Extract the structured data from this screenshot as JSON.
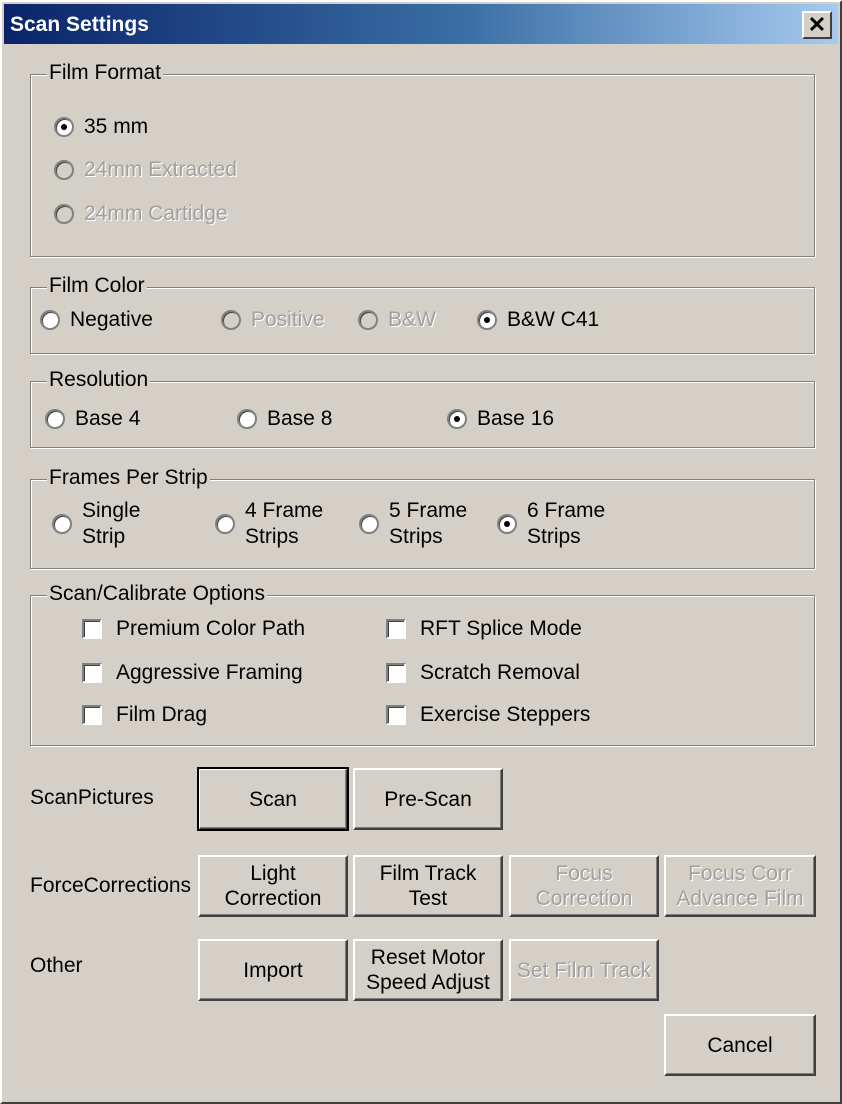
{
  "window": {
    "title": "Scan Settings",
    "close_glyph": "✕"
  },
  "film_format": {
    "label": "Film Format",
    "options": [
      {
        "label": "35 mm",
        "selected": true,
        "enabled": true
      },
      {
        "label": "24mm Extracted",
        "selected": false,
        "enabled": false
      },
      {
        "label": "24mm Cartidge",
        "selected": false,
        "enabled": false
      }
    ]
  },
  "film_color": {
    "label": "Film Color",
    "options": [
      {
        "label": "Negative",
        "selected": false,
        "enabled": true
      },
      {
        "label": "Positive",
        "selected": false,
        "enabled": false
      },
      {
        "label": "B&W",
        "selected": false,
        "enabled": false
      },
      {
        "label": "B&W C41",
        "selected": true,
        "enabled": true
      }
    ]
  },
  "resolution": {
    "label": "Resolution",
    "options": [
      {
        "label": "Base 4",
        "selected": false
      },
      {
        "label": "Base 8",
        "selected": false
      },
      {
        "label": "Base 16",
        "selected": true
      }
    ]
  },
  "frames_per_strip": {
    "label": "Frames Per Strip",
    "options": [
      {
        "line1": "Single",
        "line2": "Strip",
        "selected": false
      },
      {
        "line1": "4 Frame",
        "line2": "Strips",
        "selected": false
      },
      {
        "line1": "5 Frame",
        "line2": "Strips",
        "selected": false
      },
      {
        "line1": "6 Frame",
        "line2": "Strips",
        "selected": true
      }
    ]
  },
  "scan_options": {
    "label": "Scan/Calibrate Options",
    "items": [
      {
        "label": "Premium Color Path",
        "checked": false
      },
      {
        "label": "RFT Splice Mode",
        "checked": false
      },
      {
        "label": "Aggressive Framing",
        "checked": false
      },
      {
        "label": "Scratch Removal",
        "checked": false
      },
      {
        "label": "Film Drag",
        "checked": false
      },
      {
        "label": "Exercise Steppers",
        "checked": false
      }
    ]
  },
  "scan_pictures": {
    "label": "ScanPictures",
    "scan": "Scan",
    "prescan": "Pre-Scan"
  },
  "force_corrections": {
    "label": "ForceCorrections",
    "light_1": "Light",
    "light_2": "Correction",
    "track_1": "Film Track",
    "track_2": "Test",
    "focus_1": "Focus",
    "focus_2": "Correction",
    "focus_adv_1": "Focus Corr",
    "focus_adv_2": "Advance Film"
  },
  "other": {
    "label": "Other",
    "import": "Import",
    "reset_1": "Reset Motor",
    "reset_2": "Speed Adjust",
    "set_track": "Set Film Track"
  },
  "cancel": "Cancel"
}
